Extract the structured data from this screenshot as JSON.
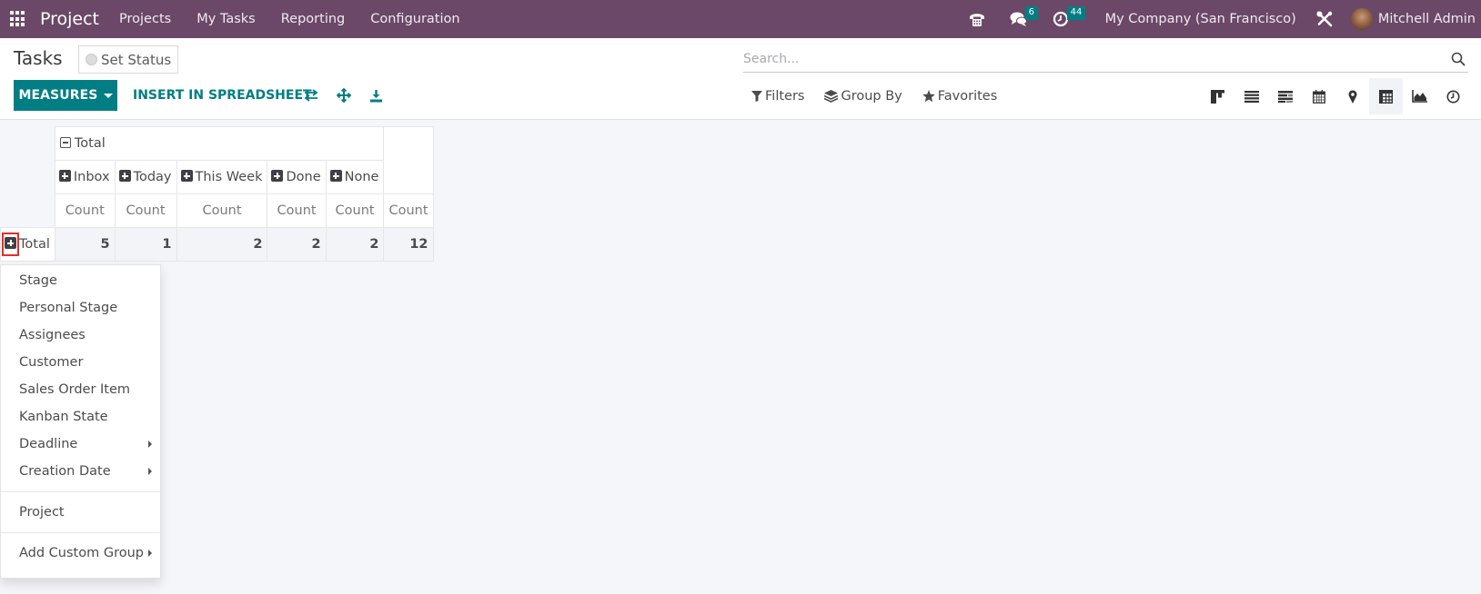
{
  "navbar": {
    "app_name": "Project",
    "menu": [
      "Projects",
      "My Tasks",
      "Reporting",
      "Configuration"
    ],
    "messages_badge": "6",
    "activities_badge": "44",
    "company": "My Company (San Francisco)",
    "user_name": "Mitchell Admin",
    "icons": [
      "apps-icon",
      "phone-icon",
      "chat-icon",
      "clock-icon",
      "tools-icon",
      "avatar"
    ]
  },
  "control_panel": {
    "title": "Tasks",
    "set_status_label": "Set Status",
    "measures_label": "MEASURES",
    "insert_label": "INSERT IN SPREADSHEET",
    "tool_icons": [
      "flip-axis-icon",
      "expand-all-icon",
      "download-icon"
    ],
    "search_placeholder": "Search...",
    "filters_label": "Filters",
    "groupby_label": "Group By",
    "favorites_label": "Favorites",
    "views": [
      "kanban",
      "list",
      "gantt",
      "calendar",
      "map",
      "pivot",
      "graph",
      "activity"
    ],
    "active_view": "pivot"
  },
  "pivot": {
    "col_total_label": "Total",
    "col_groups": [
      "Inbox",
      "Today",
      "This Week",
      "Done",
      "None"
    ],
    "measure_label": "Count",
    "row_total_label": "Total",
    "values": [
      "5",
      "1",
      "2",
      "2",
      "2"
    ],
    "grand_total": "12"
  },
  "groupby_dropdown": {
    "items": [
      {
        "label": "Stage",
        "submenu": false
      },
      {
        "label": "Personal Stage",
        "submenu": false
      },
      {
        "label": "Assignees",
        "submenu": false
      },
      {
        "label": "Customer",
        "submenu": false
      },
      {
        "label": "Sales Order Item",
        "submenu": false
      },
      {
        "label": "Kanban State",
        "submenu": false
      },
      {
        "label": "Deadline",
        "submenu": true
      },
      {
        "label": "Creation Date",
        "submenu": true
      }
    ],
    "project_label": "Project",
    "custom_group_label": "Add Custom Group"
  },
  "colors": {
    "navbar": "#6b4867",
    "primary": "#017e84",
    "highlight": "#e0302a"
  }
}
